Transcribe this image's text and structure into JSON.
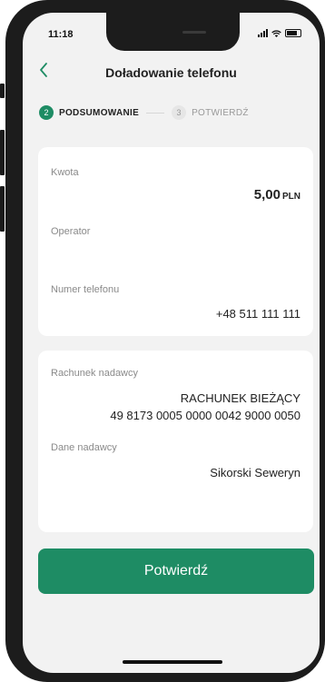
{
  "status": {
    "time": "11:18"
  },
  "header": {
    "back_icon": "chevron-left-icon",
    "title": "Doładowanie telefonu"
  },
  "steps": [
    {
      "number": "2",
      "label": "PODSUMOWANIE",
      "state": "active"
    },
    {
      "number": "3",
      "label": "POTWIERDŹ",
      "state": "inactive"
    }
  ],
  "summary": {
    "amount_label": "Kwota",
    "amount_value": "5,00",
    "amount_currency": "PLN",
    "operator_label": "Operator",
    "operator_value": "",
    "phone_label": "Numer telefonu",
    "phone_value": "+48 511 111 111"
  },
  "sender": {
    "account_label": "Rachunek nadawcy",
    "account_name": "RACHUNEK BIEŻĄCY",
    "account_number": "49 8173 0005 0000 0042 9000 0050",
    "data_label": "Dane nadawcy",
    "data_value": "Sikorski Seweryn"
  },
  "actions": {
    "confirm_label": "Potwierdź"
  },
  "colors": {
    "accent": "#1e8c64",
    "background": "#f2f2f2",
    "card": "#ffffff"
  }
}
